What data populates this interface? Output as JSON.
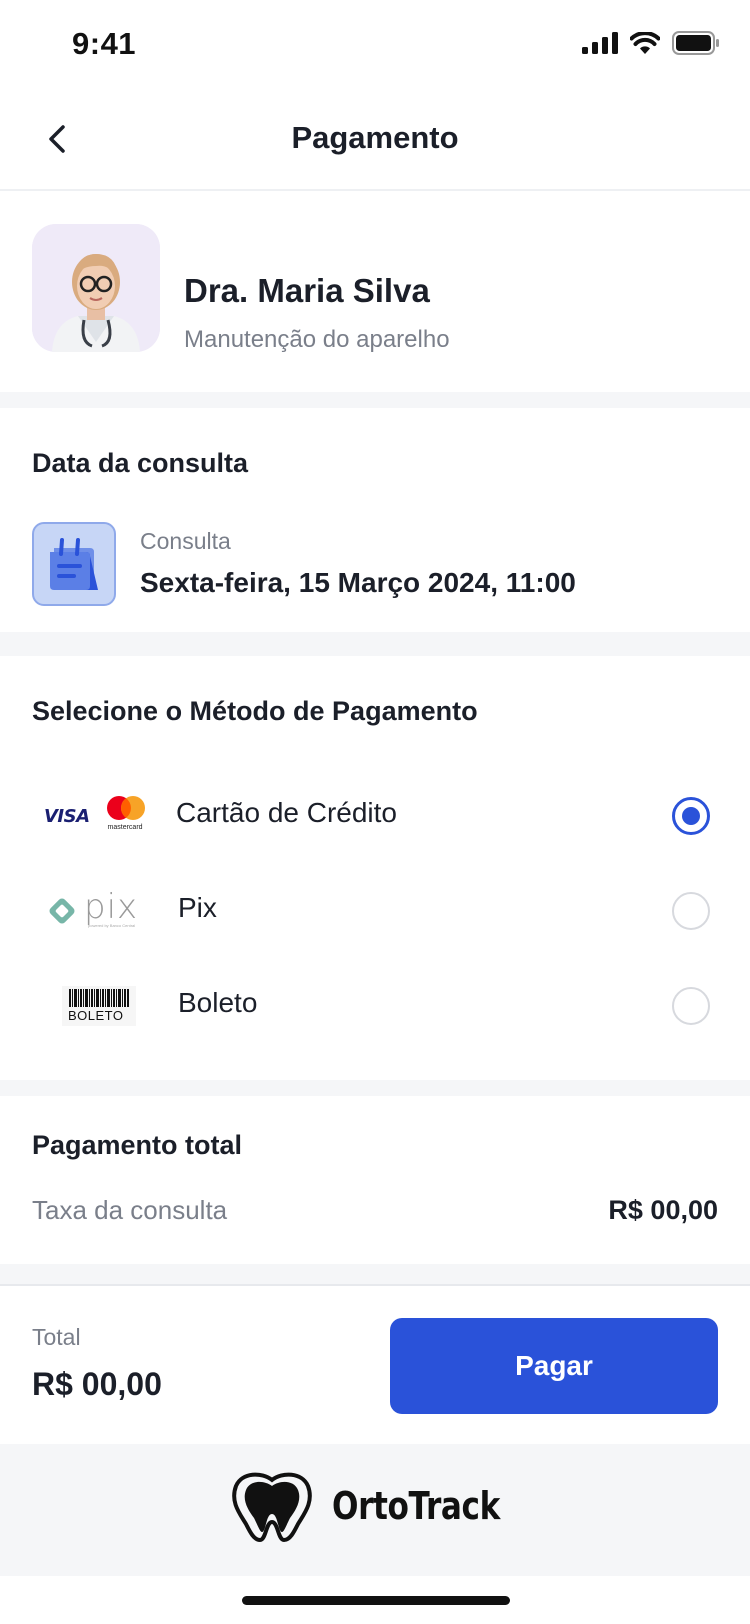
{
  "status_bar": {
    "time": "9:41"
  },
  "nav": {
    "title": "Pagamento",
    "back_icon": "chevron-left-icon"
  },
  "doctor": {
    "name": "Dra. Maria Silva",
    "subtitle": "Manutenção do aparelho"
  },
  "appointment": {
    "section_title": "Data da consulta",
    "label": "Consulta",
    "datetime": "Sexta-feira, 15 Março 2024, 11:00"
  },
  "payment_methods": {
    "section_title": "Selecione o Método de Pagamento",
    "options": [
      {
        "label": "Cartão de Crédito",
        "logo": "visa-mastercard-logo",
        "logo_text_1": "VISA",
        "logo_text_2": "mastercard",
        "selected": true
      },
      {
        "label": "Pix",
        "logo": "pix-logo",
        "logo_text_1": "pix",
        "logo_text_2": "powered by Banco Central",
        "selected": false
      },
      {
        "label": "Boleto",
        "logo": "boleto-logo",
        "logo_text_1": "BOLETO",
        "selected": false
      }
    ]
  },
  "summary": {
    "section_title": "Pagamento total",
    "fee_label": "Taxa da consulta",
    "fee_value": "R$ 00,00"
  },
  "footer": {
    "total_label": "Total",
    "total_value": "R$ 00,00",
    "pay_button": "Pagar"
  },
  "brand": {
    "name": "OrtoTrack"
  },
  "colors": {
    "accent": "#2a52d9",
    "muted_text": "#7a7f8a",
    "band": "#f5f6f8"
  }
}
